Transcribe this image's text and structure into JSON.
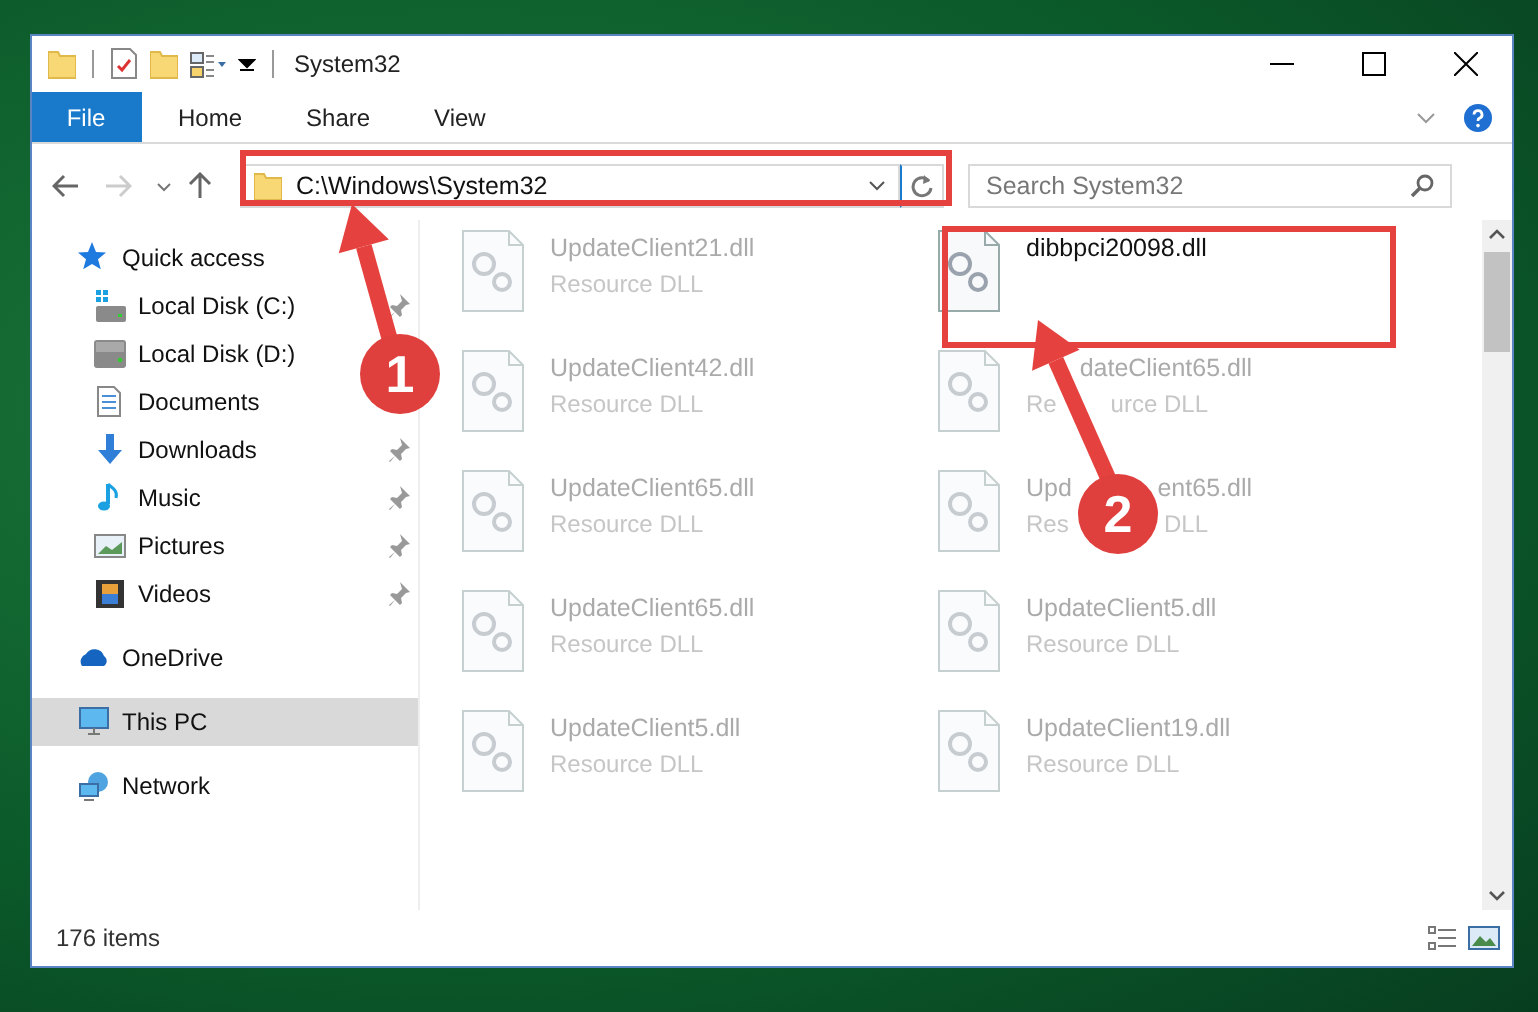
{
  "window": {
    "title": "System32"
  },
  "ribbon_tabs": [
    {
      "label": "File",
      "selected": true
    },
    {
      "label": "Home",
      "selected": false
    },
    {
      "label": "Share",
      "selected": false
    },
    {
      "label": "View",
      "selected": false
    }
  ],
  "address": {
    "value": "C:\\Windows\\System32"
  },
  "search": {
    "placeholder": "Search System32"
  },
  "sidebar": {
    "items": [
      {
        "label": "Quick access",
        "selected": false,
        "children": [
          {
            "label": "Local Disk (C:)",
            "selected": false,
            "pinned": true
          },
          {
            "label": "Local Disk (D:)",
            "selected": false
          },
          {
            "label": "Documents",
            "selected": false
          },
          {
            "label": "Downloads",
            "selected": false,
            "pinned": true
          },
          {
            "label": "Music",
            "selected": false,
            "pinned": true
          },
          {
            "label": "Pictures",
            "selected": false,
            "pinned": true
          },
          {
            "label": "Videos",
            "selected": false,
            "pinned": true
          }
        ]
      },
      {
        "label": "OneDrive",
        "selected": false
      },
      {
        "label": "This PC",
        "selected": true
      },
      {
        "label": "Network",
        "selected": false
      }
    ]
  },
  "files": [
    {
      "name": "UpdateClient21.dll",
      "type": "Resource DLL",
      "blurred": true
    },
    {
      "name": "dibbpci20098.dll",
      "blurred": false
    },
    {
      "name": "UpdateClient42.dll",
      "type": "Resource DLL",
      "blurred": true
    },
    {
      "name": [
        "dateClient65.dll"
      ],
      "type": [
        "Re",
        "urce DLL"
      ],
      "blurred": true
    },
    {
      "name": "UpdateClient65.dll",
      "type": "Resource DLL",
      "blurred": true
    },
    {
      "name": [
        "Upd",
        "ent65.dll"
      ],
      "type": [
        "Res",
        "DLL"
      ],
      "blurred": true
    },
    {
      "name": "UpdateClient65.dll",
      "type": "Resource DLL",
      "blurred": true
    },
    {
      "name": "UpdateClient5.dll",
      "type": "Resource DLL",
      "blurred": true
    },
    {
      "name": "UpdateClient5.dll",
      "type": "Resource DLL",
      "blurred": true
    },
    {
      "name": "UpdateClient19.dll",
      "type": "Resource DLL",
      "blurred": true
    }
  ],
  "status_bar": {
    "item_count": "176 items"
  },
  "annotations": [
    {
      "number": "1"
    },
    {
      "number": "2"
    }
  ]
}
